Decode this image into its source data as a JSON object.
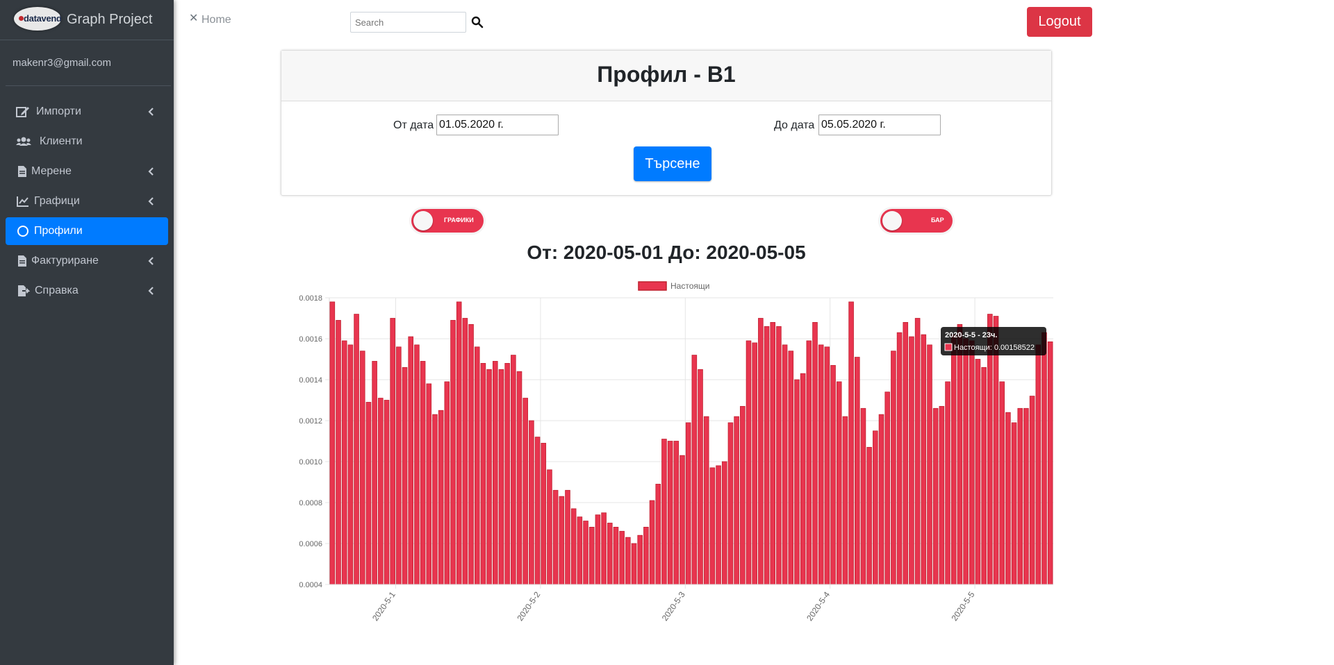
{
  "brand": {
    "logo_text": "datavend",
    "title": "Graph Project"
  },
  "user": {
    "email": "makenr3@gmail.com"
  },
  "sidebar": {
    "items": [
      {
        "label": "Импорти",
        "icon": "edit-icon",
        "has_submenu": true
      },
      {
        "label": "Клиенти",
        "icon": "users-icon",
        "has_submenu": false
      },
      {
        "label": "Мерене",
        "icon": "file-icon",
        "has_submenu": true
      },
      {
        "label": "Графици",
        "icon": "chart-line-icon",
        "has_submenu": true
      },
      {
        "label": "Профили",
        "icon": "circle-icon",
        "has_submenu": false,
        "active": true
      },
      {
        "label": "Фактуриране",
        "icon": "file-icon",
        "has_submenu": true
      },
      {
        "label": "Справка",
        "icon": "file-export-icon",
        "has_submenu": true
      }
    ]
  },
  "topbar": {
    "home_label": "Home",
    "search_placeholder": "Search",
    "logout_label": "Logout"
  },
  "card": {
    "title": "Профил - В1",
    "from_label": "От дата",
    "from_value": "01.05.2020 г.",
    "to_label": "До дата",
    "to_value": "05.05.2020 г.",
    "search_button": "Търсене"
  },
  "toggles": [
    {
      "label": "ГРАФИКИ"
    },
    {
      "label": "БАР"
    }
  ],
  "range_title": "От: 2020-05-01 До: 2020-05-05",
  "colors": {
    "sidebar_bg": "#343a40",
    "active_item": "#007bff",
    "logout": "#dc3545",
    "bar_fill": "#e8354f",
    "bar_border": "#c0202f"
  },
  "chart_data": {
    "type": "bar",
    "series": [
      {
        "name": "Настоящи",
        "values": [
          0.00178,
          0.00169,
          0.00159,
          0.00157,
          0.00172,
          0.00154,
          0.00129,
          0.00149,
          0.00131,
          0.0013,
          0.0017,
          0.00156,
          0.00146,
          0.00161,
          0.00157,
          0.00149,
          0.00138,
          0.00123,
          0.00125,
          0.00139,
          0.00169,
          0.00178,
          0.0017,
          0.00167,
          0.00156,
          0.00148,
          0.00145,
          0.00149,
          0.00145,
          0.00148,
          0.00152,
          0.00144,
          0.00131,
          0.0012,
          0.00112,
          0.00109,
          0.00096,
          0.00086,
          0.00083,
          0.00086,
          0.00077,
          0.00073,
          0.00071,
          0.00068,
          0.00074,
          0.00075,
          0.0007,
          0.00068,
          0.00066,
          0.00063,
          0.0006,
          0.00064,
          0.00068,
          0.00081,
          0.00089,
          0.00111,
          0.0011,
          0.0011,
          0.00103,
          0.00119,
          0.00152,
          0.00145,
          0.00122,
          0.00097,
          0.00098,
          0.001,
          0.00119,
          0.00122,
          0.00127,
          0.00159,
          0.00158,
          0.0017,
          0.00166,
          0.00168,
          0.00166,
          0.00157,
          0.00154,
          0.0014,
          0.00143,
          0.00159,
          0.00168,
          0.00157,
          0.00156,
          0.00147,
          0.00139,
          0.00122,
          0.00178,
          0.00151,
          0.00126,
          0.00107,
          0.00115,
          0.00123,
          0.00134,
          0.00154,
          0.00163,
          0.00168,
          0.00161,
          0.0017,
          0.00162,
          0.00157,
          0.00126,
          0.00127,
          0.00139,
          0.00162,
          0.00167,
          0.0016,
          0.00159,
          0.0015,
          0.00146,
          0.00172,
          0.00171,
          0.00139,
          0.00124,
          0.00119,
          0.00126,
          0.00126,
          0.00132,
          0.00157,
          0.00163,
          0.00158522
        ]
      }
    ],
    "x_tick_labels": [
      "2020-5-1",
      "2020-5-2",
      "2020-5-3",
      "2020-5-4",
      "2020-5-5"
    ],
    "y_tick_labels": [
      "0.0018",
      "0.0016",
      "0.0014",
      "0.0012",
      "0.0010",
      "0.0008",
      "0.0006",
      "0.0004"
    ],
    "ylim": [
      0.0004,
      0.0018
    ],
    "grid": true,
    "legend_position": "top",
    "tooltip": {
      "title": "2020-5-5 - 23ч.",
      "label": "Настоящи: 0.00158522"
    }
  }
}
